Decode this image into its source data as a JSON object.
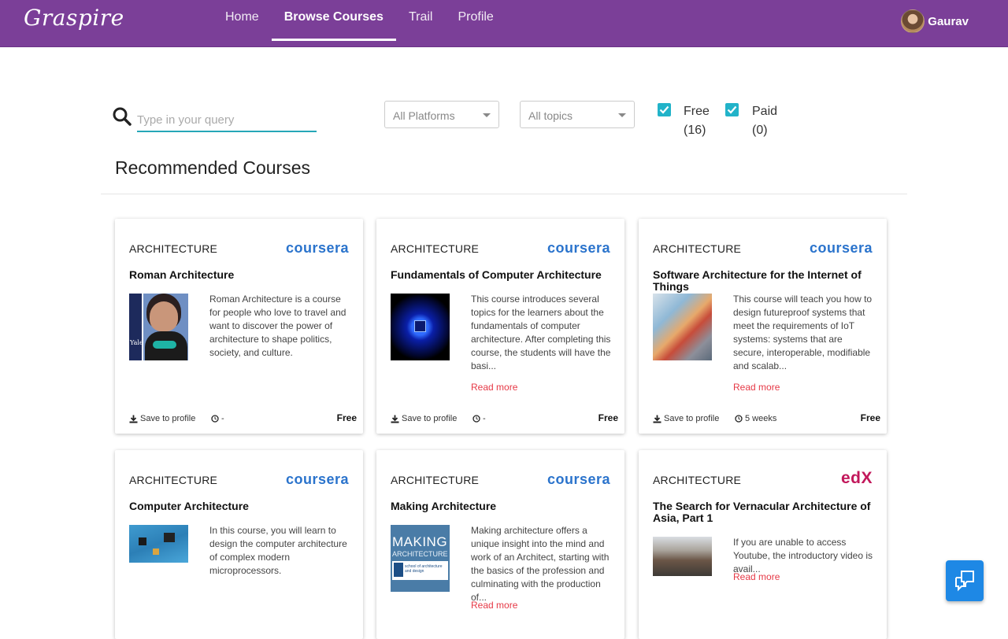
{
  "header": {
    "logo": "Graspire",
    "nav": [
      "Home",
      "Browse Courses",
      "Trail",
      "Profile"
    ],
    "active_nav": "Browse Courses",
    "user_name": "Gaurav"
  },
  "search": {
    "placeholder": "Type in your query",
    "value": ""
  },
  "filters": {
    "platform": "All Platforms",
    "topic": "All topics",
    "free_label": "Free",
    "free_count": "(16)",
    "free_checked": true,
    "paid_label": "Paid",
    "paid_count": "(0)",
    "paid_checked": true
  },
  "section_title": "Recommended Courses",
  "cards": [
    {
      "category": "ARCHITECTURE",
      "provider": "coursera",
      "title": "Roman Architecture",
      "description": "Roman Architecture is a course for people who love to travel and want to discover the power of architecture to shape politics, society, and culture.",
      "read_more": "",
      "save": "Save to profile",
      "duration": "-",
      "price": "Free",
      "thumb_text": "Yale"
    },
    {
      "category": "ARCHITECTURE",
      "provider": "coursera",
      "title": "Fundamentals of Computer Architecture",
      "description": "This course introduces several topics for the learners about the fundamentals of computer architecture. After completing this course, the students will have the basi...",
      "read_more": "Read more",
      "save": "Save to profile",
      "duration": "-",
      "price": "Free"
    },
    {
      "category": "ARCHITECTURE",
      "provider": "coursera",
      "title": "Software Architecture for the Internet of Things",
      "description": "This course will teach you how to design futureproof systems that meet the requirements of IoT systems: systems that are secure, interoperable, modifiable and scalab...",
      "read_more": "Read more",
      "save": "Save to profile",
      "duration": "5 weeks",
      "price": "Free"
    },
    {
      "category": "ARCHITECTURE",
      "provider": "coursera",
      "title": "Computer Architecture",
      "description": "In this course, you will learn to design the computer architecture of complex modern microprocessors.",
      "read_more": ""
    },
    {
      "category": "ARCHITECTURE",
      "provider": "coursera",
      "title": "Making Architecture",
      "description": "Making architecture offers a unique insight into the mind and work of an Architect, starting with the basics of the profession and culminating with the production of...",
      "read_more": "Read more",
      "thumb_text": "MAKING",
      "thumb_text2": "ARCHITECTURE",
      "thumb_text3": "school of architecture and design"
    },
    {
      "category": "ARCHITECTURE",
      "provider": "edX",
      "title": "The Search for Vernacular Architecture of Asia, Part 1",
      "description": "If you are unable to access Youtube, the introductory video is avail...",
      "read_more": "Read more"
    }
  ],
  "colors": {
    "header": "#7b3f98",
    "accent": "#22b3c9",
    "link": "#e63946",
    "coursera": "#2a73cc",
    "chat": "#1e88e5"
  }
}
